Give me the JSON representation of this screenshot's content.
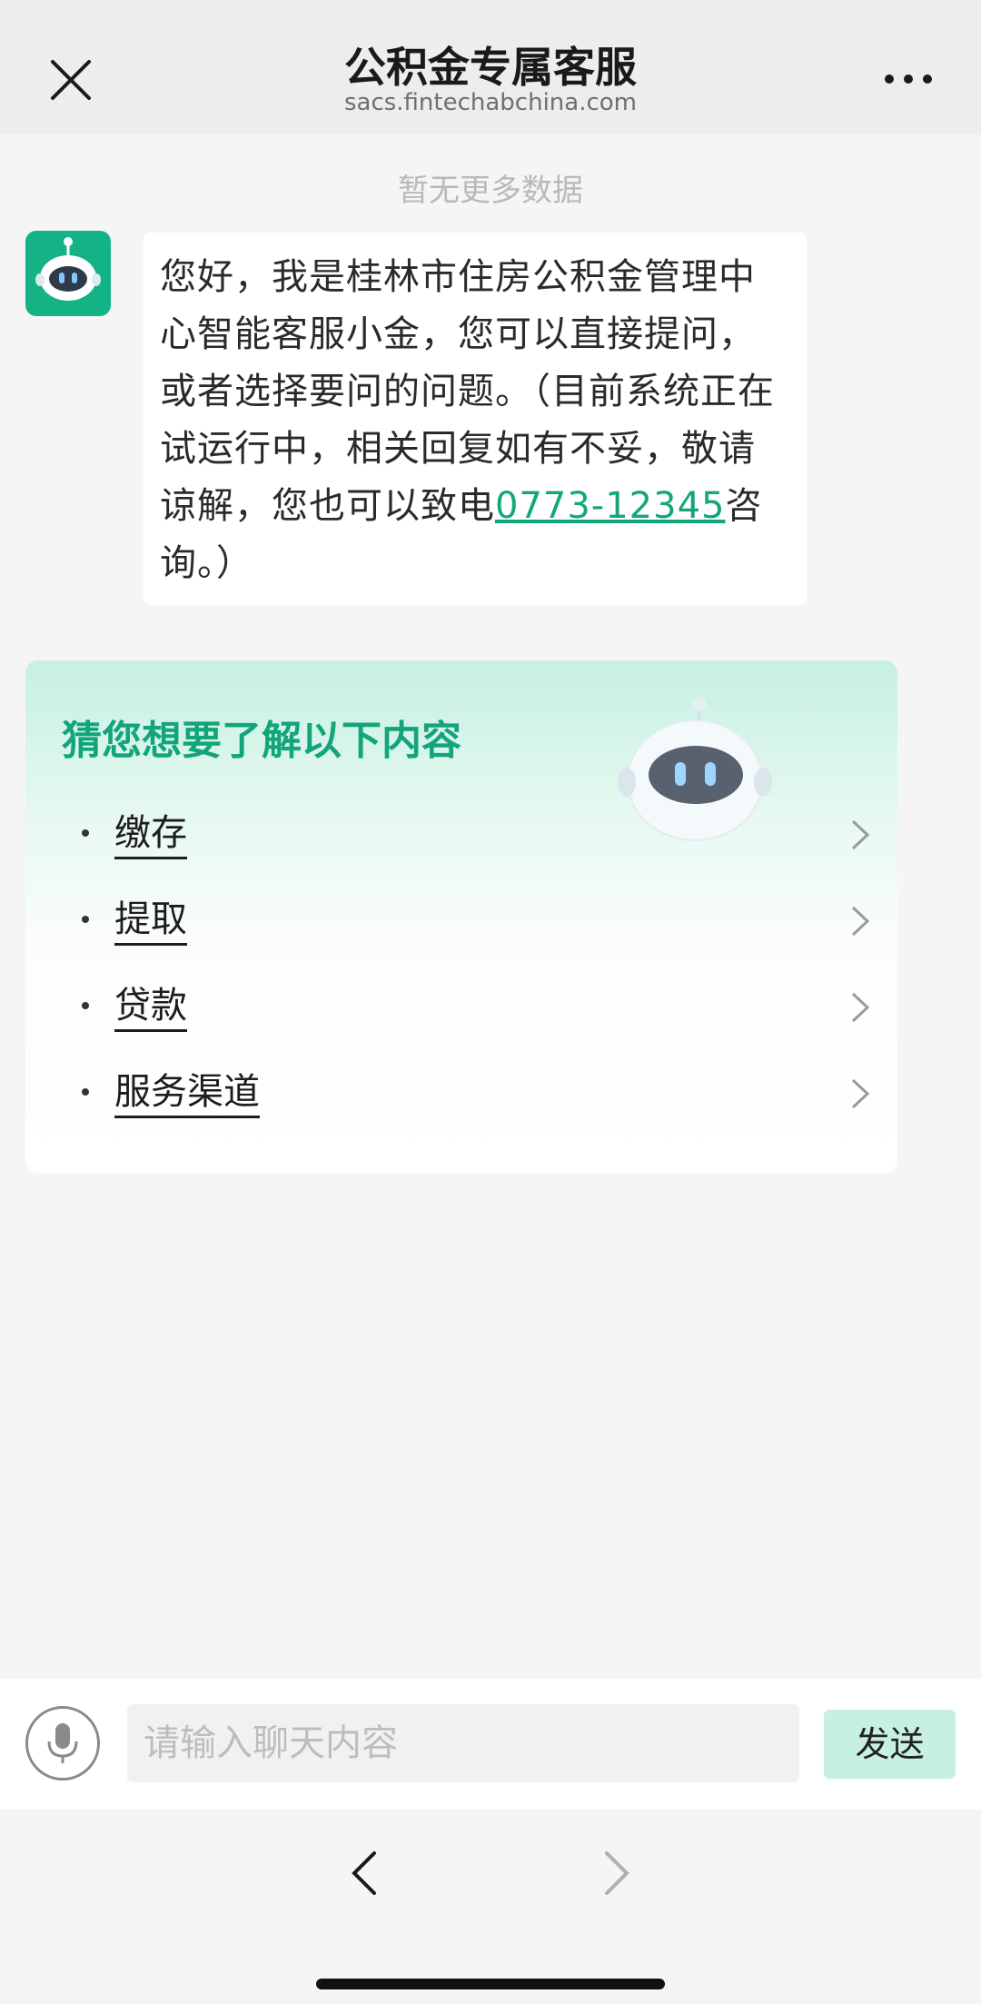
{
  "header": {
    "title": "公积金专属客服",
    "url": "sacs.fintechabchina.com",
    "close_icon": "close-icon",
    "more_icon": "more-dots-icon"
  },
  "chat": {
    "no_more_text": "暂无更多数据",
    "bot_message": {
      "text": "您好，我是桂林市住房公积金管理中心智能客服小金，您可以直接提问，或者选择要问的问题。（目前系统正在试运行中，相关回复如有不妥，敬请谅解，您也可以致电",
      "phone": "0773-12345",
      "suffix": "咨询。）"
    }
  },
  "suggestions": {
    "title": "猜您想要了解以下内容",
    "items": [
      {
        "label": "缴存"
      },
      {
        "label": "提取"
      },
      {
        "label": "贷款"
      },
      {
        "label": "服务渠道"
      }
    ]
  },
  "input_bar": {
    "placeholder": "请输入聊天内容",
    "value": "",
    "send_label": "发送",
    "mic_icon": "microphone-icon"
  },
  "nav": {
    "back_icon": "chevron-left-icon",
    "forward_icon": "chevron-right-icon"
  },
  "colors": {
    "accent": "#13a67c",
    "avatar_bg": "#14b385",
    "send_bg": "#c8f0e1",
    "header_bg": "#ededed"
  }
}
